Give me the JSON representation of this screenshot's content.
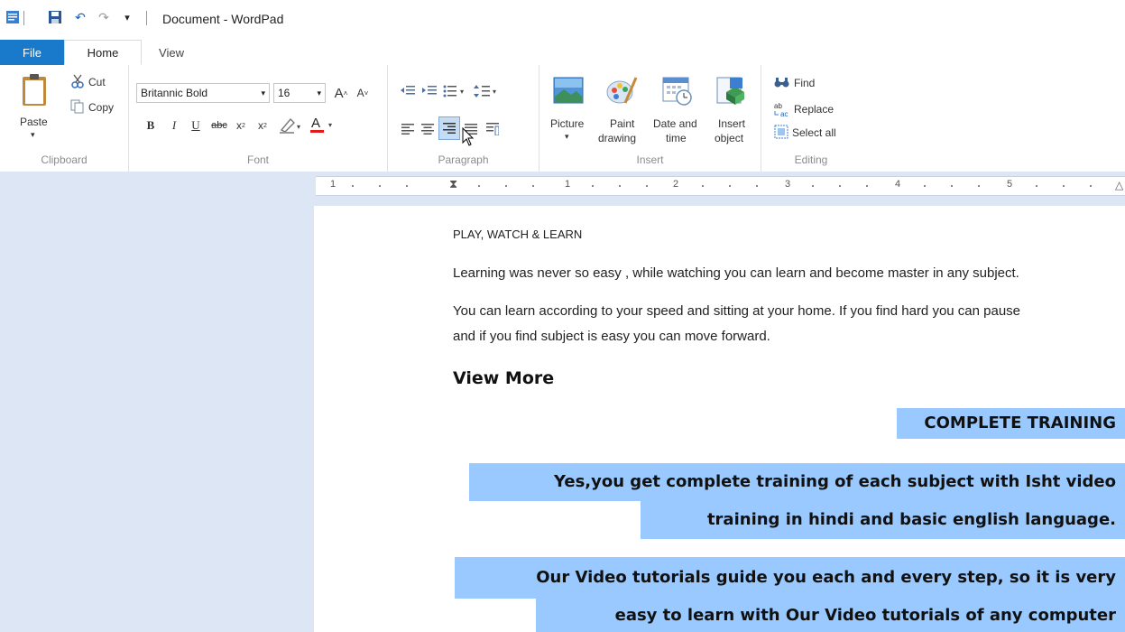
{
  "window": {
    "title": "Document - WordPad"
  },
  "tabs": {
    "file": "File",
    "home": "Home",
    "view": "View"
  },
  "clipboard": {
    "paste": "Paste",
    "cut": "Cut",
    "copy": "Copy",
    "group": "Clipboard"
  },
  "font": {
    "family": "Britannic Bold",
    "size": "16",
    "group": "Font"
  },
  "paragraph": {
    "group": "Paragraph"
  },
  "insert": {
    "picture": "Picture",
    "paint1": "Paint",
    "paint2": "drawing",
    "date1": "Date and",
    "date2": "time",
    "obj1": "Insert",
    "obj2": "object",
    "group": "Insert"
  },
  "editing": {
    "find": "Find",
    "replace": "Replace",
    "select_all": "Select all",
    "group": "Editing"
  },
  "ruler": {
    "marks": [
      "1",
      "1",
      "2",
      "3",
      "4",
      "5"
    ]
  },
  "document": {
    "line1": "PLAY, WATCH & LEARN",
    "line2": "Learning was never so easy , while watching you can learn and become master in any subject.",
    "line3a": "You can learn according to your speed and sitting at your home. If you find hard you can pause",
    "line3b": "and if you find subject is easy you can move forward.",
    "heading": "View More",
    "h_complete": "COMPLETE TRAINING",
    "p1a": "Yes,you get complete training of each subject with Isht video",
    "p1b": "training in hindi and basic english language.",
    "p2a": "Our Video tutorials guide you each and every step, so it is very",
    "p2b": "easy to learn with Our Video tutorials of any computer"
  }
}
